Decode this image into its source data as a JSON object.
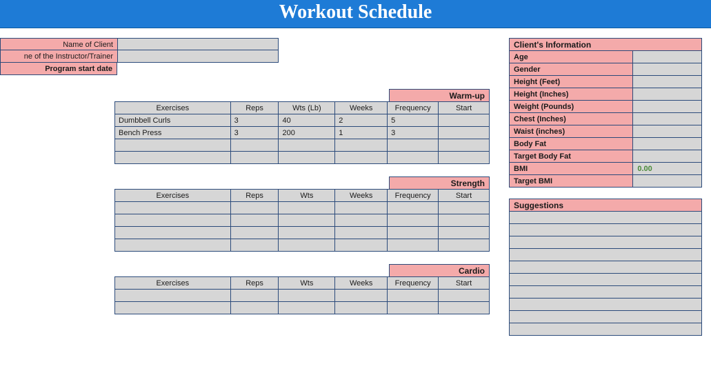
{
  "title": "Workout Schedule",
  "headerLabels": {
    "client": "Name of Client",
    "trainer": "ne of the Instructor/Trainer",
    "startDate": "Program start date",
    "clientVal": "",
    "trainerVal": ""
  },
  "sections": [
    {
      "name": "Warm-up",
      "cols": [
        "Exercises",
        "Reps",
        "Wts (Lb)",
        "Weeks",
        "Frequency",
        "Start"
      ],
      "rows": [
        {
          "ex": "Dumbbell Curls",
          "reps": "3",
          "wts": "40",
          "weeks": "2",
          "freq": "5",
          "start": ""
        },
        {
          "ex": "Bench Press",
          "reps": "3",
          "wts": "200",
          "weeks": "1",
          "freq": "3",
          "start": ""
        },
        {
          "ex": "",
          "reps": "",
          "wts": "",
          "weeks": "",
          "freq": "",
          "start": ""
        },
        {
          "ex": "",
          "reps": "",
          "wts": "",
          "weeks": "",
          "freq": "",
          "start": ""
        }
      ]
    },
    {
      "name": "Strength",
      "cols": [
        "Exercises",
        "Reps",
        "Wts",
        "Weeks",
        "Frequency",
        "Start"
      ],
      "rows": [
        {
          "ex": "",
          "reps": "",
          "wts": "",
          "weeks": "",
          "freq": "",
          "start": ""
        },
        {
          "ex": "",
          "reps": "",
          "wts": "",
          "weeks": "",
          "freq": "",
          "start": ""
        },
        {
          "ex": "",
          "reps": "",
          "wts": "",
          "weeks": "",
          "freq": "",
          "start": ""
        },
        {
          "ex": "",
          "reps": "",
          "wts": "",
          "weeks": "",
          "freq": "",
          "start": ""
        }
      ]
    },
    {
      "name": "Cardio",
      "cols": [
        "Exercises",
        "Reps",
        "Wts",
        "Weeks",
        "Frequency",
        "Start"
      ],
      "rows": [
        {
          "ex": "",
          "reps": "",
          "wts": "",
          "weeks": "",
          "freq": "",
          "start": ""
        },
        {
          "ex": "",
          "reps": "",
          "wts": "",
          "weeks": "",
          "freq": "",
          "start": ""
        }
      ]
    }
  ],
  "clientInfo": {
    "header": "Client's Information",
    "fields": [
      {
        "label": "Age",
        "value": ""
      },
      {
        "label": "Gender",
        "value": ""
      },
      {
        "label": "Height (Feet)",
        "value": ""
      },
      {
        "label": "Height (Inches)",
        "value": ""
      },
      {
        "label": "Weight (Pounds)",
        "value": ""
      },
      {
        "label": "Chest (Inches)",
        "value": ""
      },
      {
        "label": "Waist (inches)",
        "value": ""
      },
      {
        "label": "Body Fat",
        "value": ""
      },
      {
        "label": "Target Body Fat",
        "value": ""
      },
      {
        "label": "BMI",
        "value": "0.00",
        "green": true
      },
      {
        "label": "Target BMI",
        "value": ""
      }
    ]
  },
  "suggestions": {
    "header": "Suggestions",
    "rows": [
      "",
      "",
      "",
      "",
      "",
      "",
      "",
      "",
      "",
      ""
    ]
  }
}
